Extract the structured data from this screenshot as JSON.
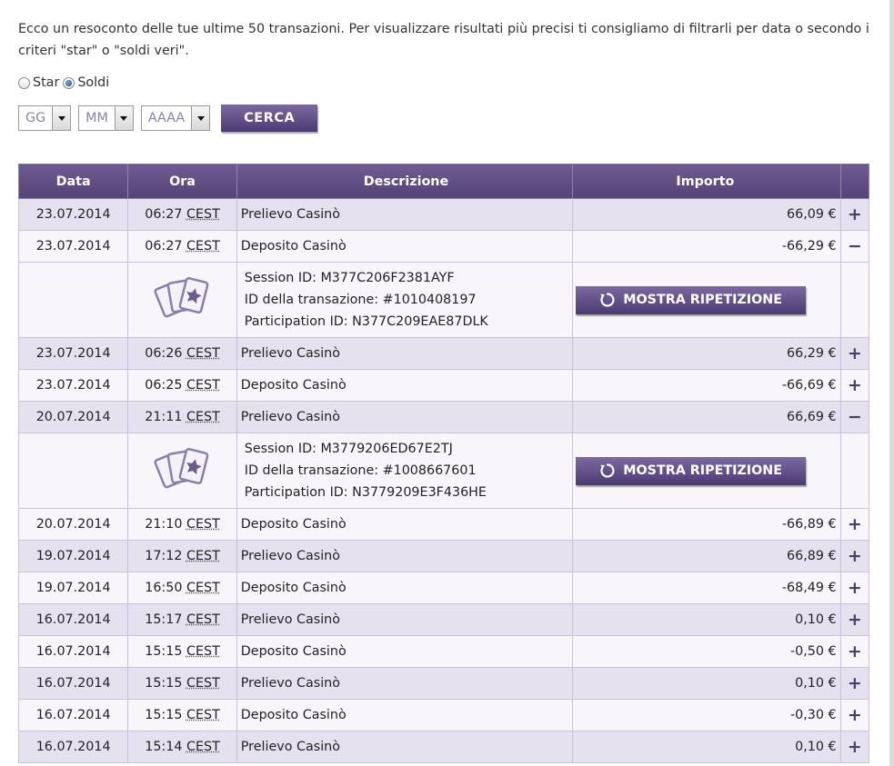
{
  "intro": "Ecco un resoconto delle tue ultime 50 transazioni. Per visualizzare risultati più precisi ti consigliamo di filtrarli per data o secondo i criteri \"star\" o \"soldi veri\".",
  "mode": {
    "star_label": "Star",
    "money_label": "Soldi",
    "selected": "Soldi"
  },
  "filters": {
    "day": "GG",
    "month": "MM",
    "year": "AAAA",
    "search_label": "CERCA"
  },
  "table": {
    "headers": {
      "date": "Data",
      "time": "Ora",
      "description": "Descrizione",
      "amount": "Importo"
    },
    "tz": "CEST",
    "replay_label": "MOSTRA RIPETIZIONE",
    "rows": [
      {
        "date": "23.07.2014",
        "time": "06:27",
        "desc": "Prelievo Casinò",
        "amount": "66,09 €",
        "toggle": "+"
      },
      {
        "date": "23.07.2014",
        "time": "06:27",
        "desc": "Deposito Casinò",
        "amount": "-66,29 €",
        "toggle": "−"
      },
      {
        "session": "Session ID: M377C206F2381AYF",
        "transaction": "ID della transazione: #1010408197",
        "participation": "Participation ID: N377C209EAE87DLK"
      },
      {
        "date": "23.07.2014",
        "time": "06:26",
        "desc": "Prelievo Casinò",
        "amount": "66,29 €",
        "toggle": "+"
      },
      {
        "date": "23.07.2014",
        "time": "06:25",
        "desc": "Deposito Casinò",
        "amount": "-66,69 €",
        "toggle": "+"
      },
      {
        "date": "20.07.2014",
        "time": "21:11",
        "desc": "Prelievo Casinò",
        "amount": "66,69 €",
        "toggle": "−"
      },
      {
        "session": "Session ID: M3779206ED67E2TJ",
        "transaction": "ID della transazione: #1008667601",
        "participation": "Participation ID: N3779209E3F436HE"
      },
      {
        "date": "20.07.2014",
        "time": "21:10",
        "desc": "Deposito Casinò",
        "amount": "-66,89 €",
        "toggle": "+"
      },
      {
        "date": "19.07.2014",
        "time": "17:12",
        "desc": "Prelievo Casinò",
        "amount": "66,89 €",
        "toggle": "+"
      },
      {
        "date": "19.07.2014",
        "time": "16:50",
        "desc": "Deposito Casinò",
        "amount": "-68,49 €",
        "toggle": "+"
      },
      {
        "date": "16.07.2014",
        "time": "15:17",
        "desc": "Prelievo Casinò",
        "amount": "0,10 €",
        "toggle": "+"
      },
      {
        "date": "16.07.2014",
        "time": "15:15",
        "desc": "Deposito Casinò",
        "amount": "-0,50 €",
        "toggle": "+"
      },
      {
        "date": "16.07.2014",
        "time": "15:15",
        "desc": "Prelievo Casinò",
        "amount": "0,10 €",
        "toggle": "+"
      },
      {
        "date": "16.07.2014",
        "time": "15:15",
        "desc": "Deposito Casinò",
        "amount": "-0,30 €",
        "toggle": "+"
      },
      {
        "date": "16.07.2014",
        "time": "15:14",
        "desc": "Prelievo Casinò",
        "amount": "0,10 €",
        "toggle": "+"
      }
    ]
  }
}
